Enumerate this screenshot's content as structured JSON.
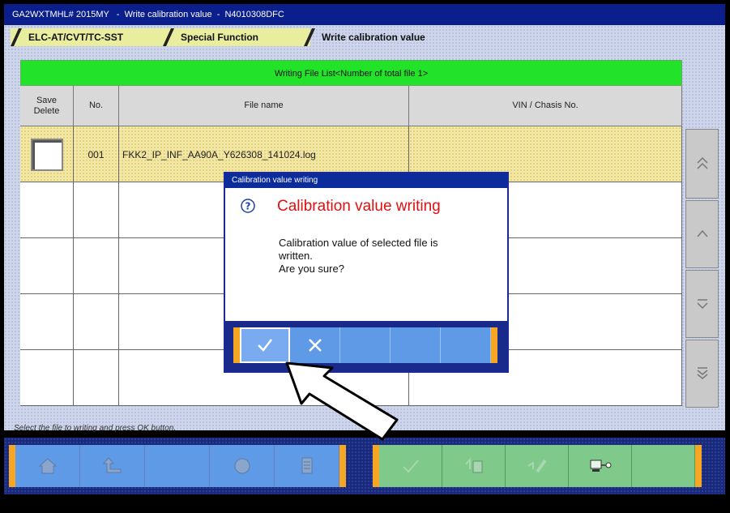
{
  "window": {
    "title": "GA2WXTMHL# 2015MY   -  Write calibration value  -  N4010308DFC"
  },
  "breadcrumb": [
    {
      "label": "ELC-AT/CVT/TC-SST"
    },
    {
      "label": "Special Function"
    },
    {
      "label": "Write calibration value"
    }
  ],
  "table": {
    "title": "Writing File List<Number of total file 1>",
    "columns": [
      "Save\nDelete",
      "No.",
      "File name",
      "VIN / Chasis No."
    ],
    "rows": [
      {
        "checked": false,
        "no": "001",
        "file_name": "FKK2_IP_INF_AA90A_Y626308_141024.log",
        "vin": ""
      },
      {
        "checked": null,
        "no": "",
        "file_name": "",
        "vin": ""
      },
      {
        "checked": null,
        "no": "",
        "file_name": "",
        "vin": ""
      },
      {
        "checked": null,
        "no": "",
        "file_name": "",
        "vin": ""
      },
      {
        "checked": null,
        "no": "",
        "file_name": "",
        "vin": ""
      }
    ]
  },
  "scroll_buttons": [
    "page-up-icon",
    "line-up-icon",
    "line-down-icon",
    "page-down-icon"
  ],
  "status_text": "Select the file to writing and press OK button.",
  "dialog": {
    "title": "Calibration value writing",
    "heading": "Calibration value writing",
    "message_lines": [
      "Calibration value of selected file is",
      "written.",
      "Are you sure?"
    ],
    "buttons": [
      "ok-check-icon",
      "cancel-x-icon",
      "",
      "",
      ""
    ]
  },
  "toolbar": {
    "left_buttons": [
      "home-icon",
      "back-icon",
      "",
      "globe-icon",
      "document-icon"
    ],
    "right_buttons": [
      "check-icon",
      "file-transfer-icon",
      "write-pen-icon",
      "computer-connect-icon",
      ""
    ]
  },
  "colors": {
    "title_bar": "#0a1e8c",
    "table_header": "#22e22a",
    "selected_row": "#f2e7a4",
    "dialog_heading": "#e01010",
    "toolbar_blue": "#5f9ae6",
    "toolbar_green": "#7fc98a",
    "accent_orange": "#f5a623"
  }
}
